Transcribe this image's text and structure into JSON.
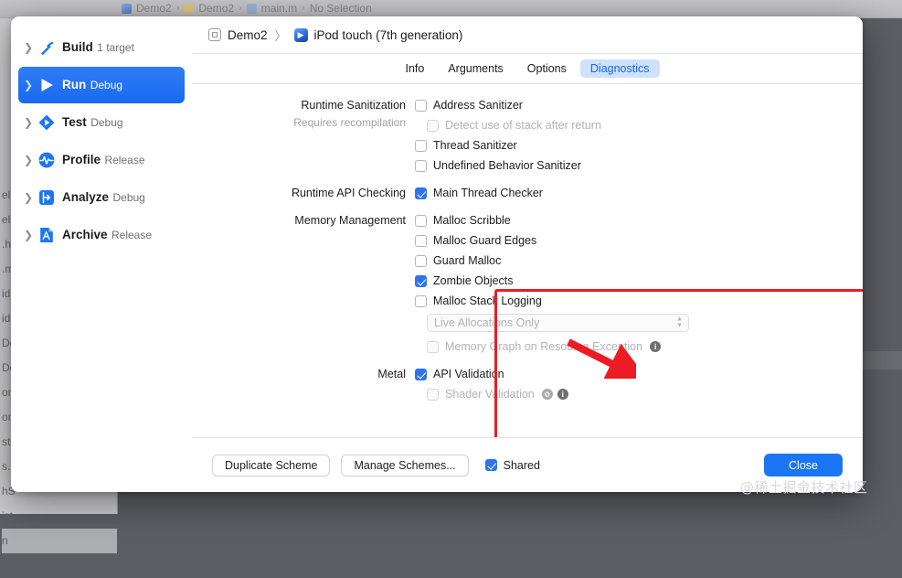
{
  "background": {
    "breadcrumb": [
      "Demo2",
      "Demo2",
      "main.m",
      "No Selection"
    ],
    "file_list": [
      "ele",
      "ele",
      ".h",
      ".m",
      "idF",
      "idF",
      "De",
      "De",
      "on",
      "on",
      "sto",
      "s.x",
      "hS",
      "ist",
      "n",
      "s"
    ]
  },
  "sidebar": {
    "items": [
      {
        "title": "Build",
        "subtitle": "1 target",
        "icon": "hammer-icon",
        "selected": false
      },
      {
        "title": "Run",
        "subtitle": "Debug",
        "icon": "play-icon",
        "selected": true
      },
      {
        "title": "Test",
        "subtitle": "Debug",
        "icon": "test-icon",
        "selected": false
      },
      {
        "title": "Profile",
        "subtitle": "Release",
        "icon": "profile-icon",
        "selected": false
      },
      {
        "title": "Analyze",
        "subtitle": "Debug",
        "icon": "analyze-icon",
        "selected": false
      },
      {
        "title": "Archive",
        "subtitle": "Release",
        "icon": "archive-icon",
        "selected": false
      }
    ]
  },
  "header": {
    "scheme_name": "Demo2",
    "separator": "〉",
    "destination": "iPod touch (7th generation)"
  },
  "tabs": [
    {
      "label": "Info",
      "active": false
    },
    {
      "label": "Arguments",
      "active": false
    },
    {
      "label": "Options",
      "active": false
    },
    {
      "label": "Diagnostics",
      "active": true
    }
  ],
  "diagnostics": {
    "runtime_sanitization": {
      "label": "Runtime Sanitization",
      "sublabel": "Requires recompilation",
      "options": [
        {
          "label": "Address Sanitizer",
          "checked": false,
          "disabled": false,
          "indent": false
        },
        {
          "label": "Detect use of stack after return",
          "checked": false,
          "disabled": true,
          "indent": true
        },
        {
          "label": "Thread Sanitizer",
          "checked": false,
          "disabled": false,
          "indent": false
        },
        {
          "label": "Undefined Behavior Sanitizer",
          "checked": false,
          "disabled": false,
          "indent": false
        }
      ]
    },
    "runtime_api_checking": {
      "label": "Runtime API Checking",
      "options": [
        {
          "label": "Main Thread Checker",
          "checked": true,
          "disabled": false,
          "indent": false
        }
      ]
    },
    "memory_management": {
      "label": "Memory Management",
      "options": [
        {
          "label": "Malloc Scribble",
          "checked": false,
          "disabled": false,
          "indent": false
        },
        {
          "label": "Malloc Guard Edges",
          "checked": false,
          "disabled": false,
          "indent": false
        },
        {
          "label": "Guard Malloc",
          "checked": false,
          "disabled": false,
          "indent": false
        },
        {
          "label": "Zombie Objects",
          "checked": true,
          "disabled": false,
          "indent": false
        },
        {
          "label": "Malloc Stack Logging",
          "checked": false,
          "disabled": false,
          "indent": false
        }
      ],
      "stack_logging_mode": "Live Allocations Only",
      "memory_graph": {
        "label": "Memory Graph on Resource Exception",
        "checked": false,
        "disabled": true
      }
    },
    "metal": {
      "label": "Metal",
      "options": [
        {
          "label": "API Validation",
          "checked": true,
          "disabled": false,
          "indent": false
        },
        {
          "label": "Shader Validation",
          "checked": false,
          "disabled": true,
          "indent": true
        }
      ]
    }
  },
  "footer": {
    "duplicate_scheme": "Duplicate Scheme",
    "manage_schemes": "Manage Schemes...",
    "shared_label": "Shared",
    "shared_checked": true,
    "close": "Close"
  },
  "watermark": "@稀土掘金技术社区",
  "colors": {
    "accent_blue": "#1a76f2",
    "tab_active_bg": "#cfe2fd",
    "tab_active_fg": "#1068f0",
    "annotation_red": "#ec1b24",
    "checkbox_blue": "#2f73f0"
  }
}
